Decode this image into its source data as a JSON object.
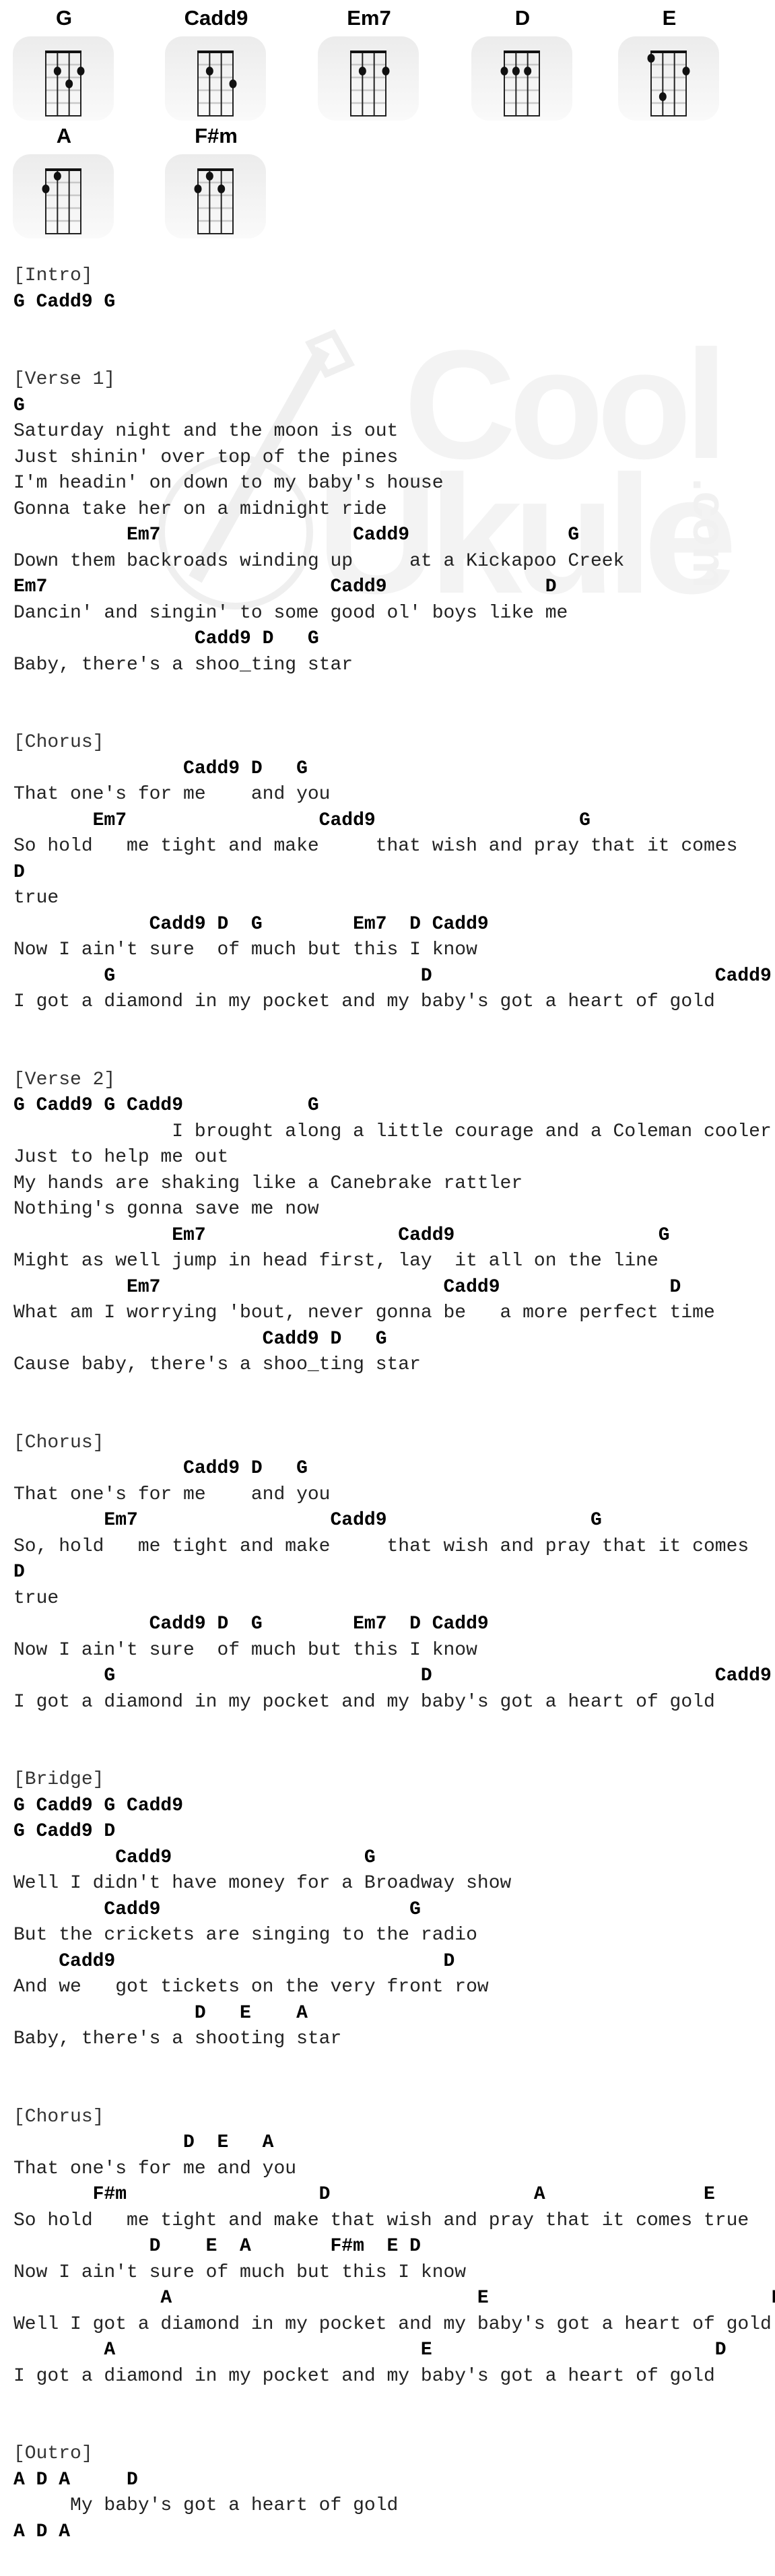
{
  "chord_diagrams": [
    {
      "name": "G",
      "frets": [
        0,
        2,
        3,
        2
      ]
    },
    {
      "name": "Cadd9",
      "frets": [
        0,
        2,
        0,
        3
      ]
    },
    {
      "name": "Em7",
      "frets": [
        0,
        2,
        0,
        2
      ]
    },
    {
      "name": "D",
      "frets": [
        2,
        2,
        2,
        0
      ]
    },
    {
      "name": "E",
      "frets": [
        1,
        4,
        0,
        2
      ]
    },
    {
      "name": "A",
      "frets": [
        2,
        1,
        0,
        0
      ]
    },
    {
      "name": "F#m",
      "frets": [
        2,
        1,
        2,
        0
      ]
    }
  ],
  "watermark": {
    "line1": "Cool",
    "line2": "Ukulele",
    "suffix": ".com"
  },
  "sheet": [
    {
      "type": "label",
      "text": "[Intro]"
    },
    {
      "type": "chords",
      "text": "G Cadd9 G"
    },
    {
      "type": "blank",
      "text": ""
    },
    {
      "type": "blank",
      "text": ""
    },
    {
      "type": "label",
      "text": "[Verse 1]"
    },
    {
      "type": "chords",
      "text": "G"
    },
    {
      "type": "lyric",
      "text": "Saturday night and the moon is out"
    },
    {
      "type": "lyric",
      "text": "Just shinin' over top of the pines"
    },
    {
      "type": "lyric",
      "text": "I'm headin' on down to my baby's house"
    },
    {
      "type": "lyric",
      "text": "Gonna take her on a midnight ride"
    },
    {
      "type": "chords",
      "text": "          Em7                 Cadd9              G"
    },
    {
      "type": "lyric",
      "text": "Down them backroads winding up     at a Kickapoo Creek"
    },
    {
      "type": "chords",
      "text": "Em7                         Cadd9              D"
    },
    {
      "type": "lyric",
      "text": "Dancin' and singin' to some good ol' boys like me"
    },
    {
      "type": "chords",
      "text": "                Cadd9 D   G"
    },
    {
      "type": "lyric",
      "text": "Baby, there's a shoo_ting star"
    },
    {
      "type": "blank",
      "text": ""
    },
    {
      "type": "blank",
      "text": ""
    },
    {
      "type": "label",
      "text": "[Chorus]"
    },
    {
      "type": "chords",
      "text": "               Cadd9 D   G"
    },
    {
      "type": "lyric",
      "text": "That one's for me    and you"
    },
    {
      "type": "chords",
      "text": "       Em7                 Cadd9                  G"
    },
    {
      "type": "lyric",
      "text": "So hold   me tight and make     that wish and pray that it comes"
    },
    {
      "type": "chords",
      "text": "D"
    },
    {
      "type": "lyric",
      "text": "true"
    },
    {
      "type": "chords",
      "text": "            Cadd9 D  G        Em7  D Cadd9"
    },
    {
      "type": "lyric",
      "text": "Now I ain't sure  of much but this I know"
    },
    {
      "type": "chords",
      "text": "        G                           D                         Cadd9"
    },
    {
      "type": "lyric",
      "text": "I got a diamond in my pocket and my baby's got a heart of gold"
    },
    {
      "type": "blank",
      "text": ""
    },
    {
      "type": "blank",
      "text": ""
    },
    {
      "type": "label",
      "text": "[Verse 2]"
    },
    {
      "type": "chords",
      "text": "G Cadd9 G Cadd9           G"
    },
    {
      "type": "lyric",
      "text": "              I brought along a little courage and a Coleman cooler"
    },
    {
      "type": "lyric",
      "text": "Just to help me out"
    },
    {
      "type": "lyric",
      "text": "My hands are shaking like a Canebrake rattler"
    },
    {
      "type": "lyric",
      "text": "Nothing's gonna save me now"
    },
    {
      "type": "chords",
      "text": "              Em7                 Cadd9                  G"
    },
    {
      "type": "lyric",
      "text": "Might as well jump in head first, lay  it all on the line"
    },
    {
      "type": "chords",
      "text": "          Em7                         Cadd9               D"
    },
    {
      "type": "lyric",
      "text": "What am I worrying 'bout, never gonna be   a more perfect time"
    },
    {
      "type": "chords",
      "text": "                      Cadd9 D   G"
    },
    {
      "type": "lyric",
      "text": "Cause baby, there's a shoo_ting star"
    },
    {
      "type": "blank",
      "text": ""
    },
    {
      "type": "blank",
      "text": ""
    },
    {
      "type": "label",
      "text": "[Chorus]"
    },
    {
      "type": "chords",
      "text": "               Cadd9 D   G"
    },
    {
      "type": "lyric",
      "text": "That one's for me    and you"
    },
    {
      "type": "chords",
      "text": "        Em7                 Cadd9                  G"
    },
    {
      "type": "lyric",
      "text": "So, hold   me tight and make     that wish and pray that it comes"
    },
    {
      "type": "chords",
      "text": "D"
    },
    {
      "type": "lyric",
      "text": "true"
    },
    {
      "type": "chords",
      "text": "            Cadd9 D  G        Em7  D Cadd9"
    },
    {
      "type": "lyric",
      "text": "Now I ain't sure  of much but this I know"
    },
    {
      "type": "chords",
      "text": "        G                           D                         Cadd9"
    },
    {
      "type": "lyric",
      "text": "I got a diamond in my pocket and my baby's got a heart of gold"
    },
    {
      "type": "blank",
      "text": ""
    },
    {
      "type": "blank",
      "text": ""
    },
    {
      "type": "label",
      "text": "[Bridge]"
    },
    {
      "type": "chords",
      "text": "G Cadd9 G Cadd9"
    },
    {
      "type": "chords",
      "text": "G Cadd9 D"
    },
    {
      "type": "chords",
      "text": "         Cadd9                 G"
    },
    {
      "type": "lyric",
      "text": "Well I didn't have money for a Broadway show"
    },
    {
      "type": "chords",
      "text": "        Cadd9                      G"
    },
    {
      "type": "lyric",
      "text": "But the crickets are singing to the radio"
    },
    {
      "type": "chords",
      "text": "    Cadd9                             D"
    },
    {
      "type": "lyric",
      "text": "And we   got tickets on the very front row"
    },
    {
      "type": "chords",
      "text": "                D   E    A"
    },
    {
      "type": "lyric",
      "text": "Baby, there's a shooting star"
    },
    {
      "type": "blank",
      "text": ""
    },
    {
      "type": "blank",
      "text": ""
    },
    {
      "type": "label",
      "text": "[Chorus]"
    },
    {
      "type": "chords",
      "text": "               D  E   A"
    },
    {
      "type": "lyric",
      "text": "That one's for me and you"
    },
    {
      "type": "chords",
      "text": "       F#m                 D                  A              E"
    },
    {
      "type": "lyric",
      "text": "So hold   me tight and make that wish and pray that it comes true"
    },
    {
      "type": "chords",
      "text": "            D    E  A       F#m  E D"
    },
    {
      "type": "lyric",
      "text": "Now I ain't sure of much but this I know"
    },
    {
      "type": "chords",
      "text": "             A                           E                         D"
    },
    {
      "type": "lyric",
      "text": "Well I got a diamond in my pocket and my baby's got a heart of gold"
    },
    {
      "type": "chords",
      "text": "        A                           E                         D"
    },
    {
      "type": "lyric",
      "text": "I got a diamond in my pocket and my baby's got a heart of gold"
    },
    {
      "type": "blank",
      "text": ""
    },
    {
      "type": "blank",
      "text": ""
    },
    {
      "type": "label",
      "text": "[Outro]"
    },
    {
      "type": "chords",
      "text": "A D A     D"
    },
    {
      "type": "lyric",
      "text": "     My baby's got a heart of gold"
    },
    {
      "type": "chords",
      "text": "A D A"
    }
  ]
}
